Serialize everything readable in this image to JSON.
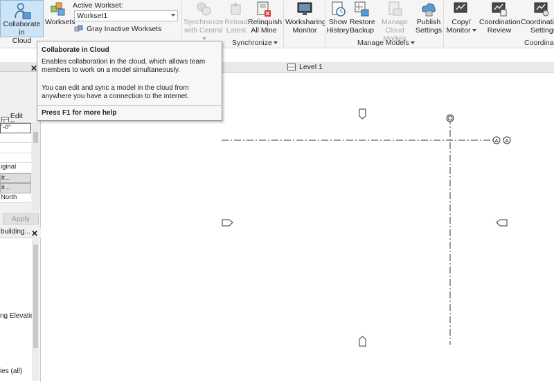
{
  "ribbon": {
    "collaborate_label_1": "Collaborate in",
    "collaborate_label_2": "Cloud",
    "worksets_label": "Worksets",
    "active_workset_label": "Active Workset:",
    "active_workset_value": "Workset1",
    "gray_inactive_label": "Gray Inactive Worksets",
    "sync_central_1": "Synchronize",
    "sync_central_2": "with Central",
    "reload_latest_1": "Reload",
    "reload_latest_2": "Latest",
    "relinquish_1": "Relinquish",
    "relinquish_2": "All Mine",
    "ws_monitor_1": "Worksharing",
    "ws_monitor_2": "Monitor",
    "show_history_1": "Show",
    "show_history_2": "History",
    "restore_backup_1": "Restore",
    "restore_backup_2": "Backup",
    "manage_cloud_1": "Manage",
    "manage_cloud_2": "Cloud Models",
    "publish_settings_1": "Publish",
    "publish_settings_2": "Settings",
    "copy_monitor_1": "Copy/",
    "copy_monitor_2": "Monitor",
    "coord_review_1": "Coordination",
    "coord_review_2": "Review",
    "coord_settings_1": "Coordination",
    "coord_settings_2": "Settings",
    "panel_synchronize": "Synchronize",
    "panel_manage_models": "Manage Models",
    "panel_coordinate": "Coordinate"
  },
  "tooltip": {
    "title": "Collaborate in Cloud",
    "description": "Enables collaboration in the cloud, which allows team members to work on a model simultaneously.",
    "description2": "You can edit and sync a model in the cloud from anywhere you have a connection to the internet.",
    "help": "Press F1 for more help"
  },
  "properties": {
    "edit_type": "Edit Type",
    "rows": [
      "'-0\"",
      "",
      "",
      "",
      "iginal",
      "it...",
      "it...",
      "North"
    ],
    "apply": "Apply"
  },
  "browser": {
    "header": "building...",
    "item_elevations": "ng Elevatio",
    "item_all": "ies (all)"
  },
  "view": {
    "level_tab": "Level 1",
    "grid_label": "A"
  },
  "colors": {
    "selected_bg": "#cde4f7",
    "error_red": "#d9302c"
  }
}
